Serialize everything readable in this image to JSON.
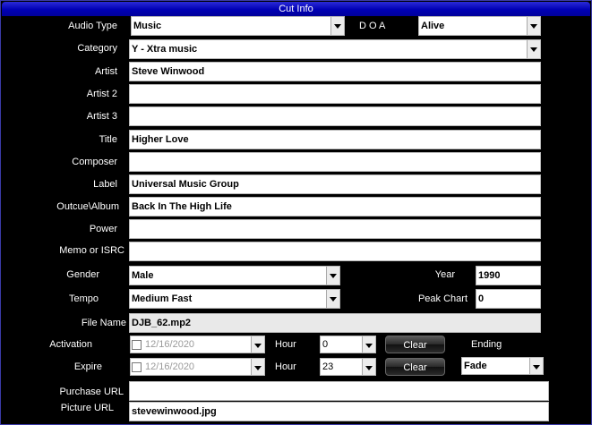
{
  "title": "Cut Info",
  "labels": {
    "audio_type": "Audio Type",
    "doa": "D O A",
    "category": "Category",
    "artist": "Artist",
    "artist2": "Artist 2",
    "artist3": "Artist 3",
    "title": "Title",
    "composer": "Composer",
    "label": "Label",
    "album": "Outcue\\Album",
    "power": "Power",
    "memo": "Memo or ISRC",
    "gender": "Gender",
    "year": "Year",
    "tempo": "Tempo",
    "peak_chart": "Peak Chart",
    "file_name": "File Name",
    "activation": "Activation",
    "hour": "Hour",
    "ending": "Ending",
    "expire": "Expire",
    "hour2": "Hour",
    "purchase_url": "Purchase URL",
    "picture_url": "Picture URL"
  },
  "values": {
    "audio_type": "Music",
    "doa": "Alive",
    "category": "Y - Xtra music",
    "artist": "Steve Winwood",
    "artist2": "",
    "artist3": "",
    "title": "Higher Love",
    "composer": "",
    "label": "Universal Music Group",
    "album": "Back In The High Life",
    "power": "",
    "memo": "",
    "gender": "Male",
    "year": "1990",
    "tempo": "Medium Fast",
    "peak_chart": "0",
    "file_name": "DJB_62.mp2",
    "activation_date": "12/16/2020",
    "activation_hour": "0",
    "expire_date": "12/16/2020",
    "expire_hour": "23",
    "ending": "Fade",
    "purchase_url": "",
    "picture_url": "stevewinwood.jpg"
  },
  "buttons": {
    "clear1": "Clear",
    "clear2": "Clear"
  },
  "icons": {
    "dropdown": "chevron-down-icon",
    "checkbox": "checkbox-icon"
  },
  "colors": {
    "title_bar": "#0000b4",
    "background": "#000000",
    "field": "#ffffff"
  }
}
